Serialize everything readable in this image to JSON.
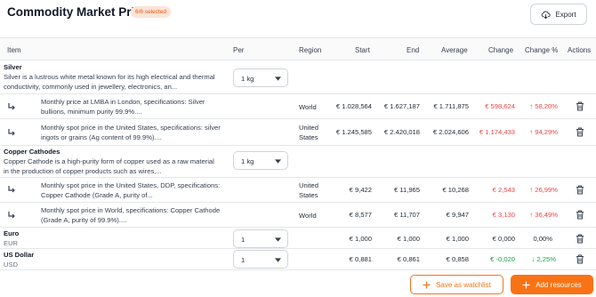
{
  "header": {
    "title": "Commodity Market Prices",
    "badge": "6/6 selected",
    "export_label": "Export"
  },
  "columns": {
    "item": "Item",
    "per": "Per",
    "region": "Region",
    "start": "Start",
    "end": "End",
    "average": "Average",
    "change": "Change",
    "change_pct": "Change %",
    "actions": "Actions"
  },
  "colors": {
    "accent": "#f97316",
    "negative": "#ef4444",
    "positive": "#16a34a"
  },
  "groups": {
    "silver": {
      "name": "Silver",
      "description": "Silver is a lustrous white metal known for its high electrical and thermal conductivity, commonly used in jewellery, electronics, an...",
      "per": "1 kg",
      "rows": [
        {
          "description": "Monthly price at LMBA in London, specifications: Silver bullions, minimum purity 99.9%....",
          "region": "World",
          "start": "€ 1.028,564",
          "end": "€ 1.627,187",
          "average": "€ 1.711,875",
          "change": "€ 598,624",
          "change_pct": "↑ 58,20%"
        },
        {
          "description": "Monthly spot price in the United States, specifications: silver ingots or grains (Ag content of 99.9%)....",
          "region": "United States",
          "start": "€ 1.245,585",
          "end": "€ 2.420,018",
          "average": "€ 2.024,606",
          "change": "€ 1.174,433",
          "change_pct": "↑ 94,29%"
        }
      ]
    },
    "copper": {
      "name": "Copper Cathodes",
      "description": "Copper Cathode is a high-purity form of copper used as a raw material in the production of copper products such as wires,...",
      "per": "1 kg",
      "rows": [
        {
          "description": "Monthly spot price in the United States, DDP, specifications: Copper Cathode (Grade A, purity of...",
          "region": "United States",
          "start": "€ 9,422",
          "end": "€ 11,965",
          "average": "€ 10,268",
          "change": "€ 2,543",
          "change_pct": "↑ 26,99%"
        },
        {
          "description": "Monthly spot price in World, specifications: Copper Cathode (Grade A, purity of 99.9%)....",
          "region": "World",
          "start": "€ 8,577",
          "end": "€ 11,707",
          "average": "€ 9,947",
          "change": "€ 3,130",
          "change_pct": "↑ 36,49%"
        }
      ]
    },
    "euro": {
      "name": "Euro",
      "unit": "EUR",
      "per": "1",
      "start": "€ 1,000",
      "end": "€ 1,000",
      "average": "€ 1,000",
      "change": "€ 0,000",
      "change_pct": "0,00%"
    },
    "usd": {
      "name": "US Dollar",
      "unit": "USD",
      "per": "1",
      "start": "€ 0,881",
      "end": "€ 0,861",
      "average": "€ 0,858",
      "change": "€ -0,020",
      "change_pct": "↓ 2,25%"
    }
  },
  "footer": {
    "watchlist_label": "Save as watchlist",
    "add_label": "Add resources"
  }
}
